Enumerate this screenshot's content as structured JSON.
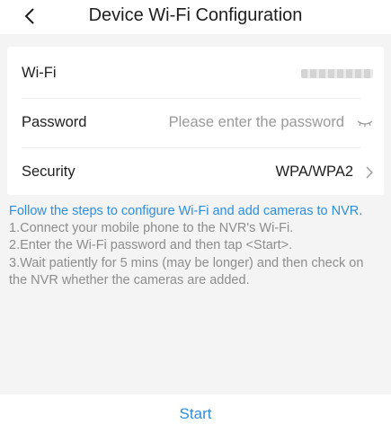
{
  "header": {
    "title": "Device Wi-Fi Configuration"
  },
  "form": {
    "wifi_label": "Wi-Fi",
    "password_label": "Password",
    "password_placeholder": "Please enter the password",
    "security_label": "Security",
    "security_value": "WPA/WPA2"
  },
  "instructions": {
    "lead": "Follow the steps to configure Wi-Fi and add cameras to NVR.",
    "steps": [
      "1.Connect your mobile phone to the NVR's Wi-Fi.",
      "2.Enter the Wi-Fi password and then tap <Start>.",
      "3.Wait patiently for 5 mins (may be longer) and then check on the NVR whether the cameras are added."
    ]
  },
  "footer": {
    "start_label": "Start"
  },
  "colors": {
    "accent": "#2d8ee0",
    "text": "#1f1f1f",
    "muted": "#8d8d8d",
    "background": "#f4f4f4"
  },
  "icons": [
    "chevron-left-icon",
    "eye-closed-icon",
    "chevron-right-icon"
  ]
}
